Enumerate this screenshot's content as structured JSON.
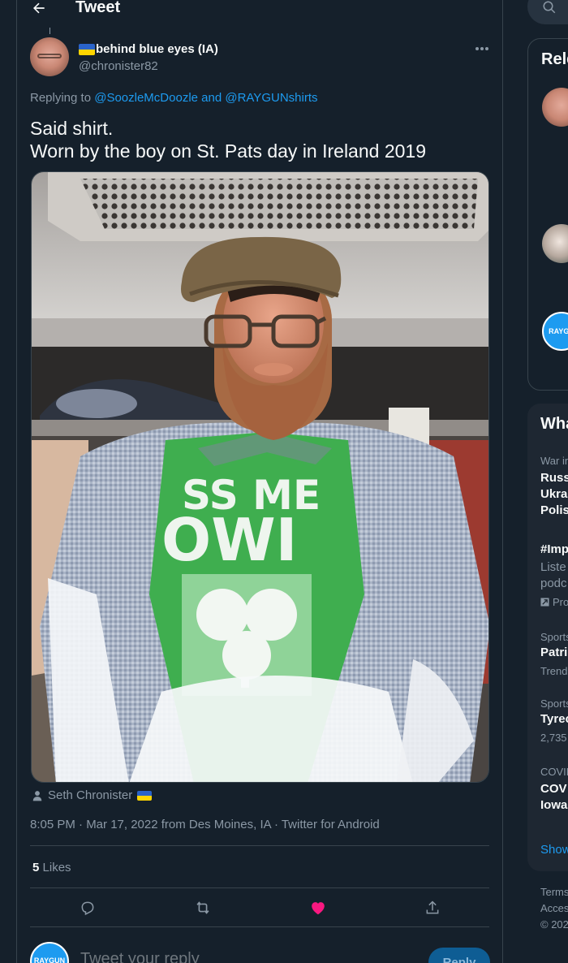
{
  "header": {
    "title": "Tweet"
  },
  "tweet": {
    "author": {
      "display_name": "behind blue eyes (IA)",
      "handle": "@chronister82"
    },
    "replying_prefix": "Replying to",
    "replying_to": "@SoozleMcDoozle and @RAYGUNshirts",
    "text_lines": [
      "Said shirt.",
      "Worn by the boy on St. Pats day in Ireland 2019"
    ],
    "photo": {
      "shirt_text_line1": "SS ME",
      "shirt_text_line2": "OWI"
    },
    "tagged_user": "Seth Chronister",
    "timestamp": "8:05 PM · Mar 17, 2022 from Des Moines, IA · Twitter for Android",
    "likes_count": "5",
    "likes_label": "Likes",
    "liked": true,
    "colors": {
      "accent": "#1d9bf0",
      "like": "#f91880",
      "background": "#15202b"
    }
  },
  "reply_box": {
    "avatar_label": "RAYGUN",
    "placeholder": "Tweet your reply",
    "button_label": "Reply"
  },
  "right_sidebar": {
    "relevant_title": "Rele",
    "relevant_avatar_label": "RAYGU",
    "whats_happening_title": "Wha",
    "trends": [
      {
        "context": "War in",
        "title_lines": [
          "Russ",
          "Ukra",
          "Polis"
        ]
      },
      {
        "title": "#Imp",
        "desc_lines": [
          "Liste",
          "podc"
        ],
        "promoted": "Pro"
      },
      {
        "context": "Sports",
        "title": "Patri",
        "meta": "Trend"
      },
      {
        "context": "Sports",
        "title": "Tyrec",
        "meta": "2,735"
      },
      {
        "context": "COVID",
        "title_lines": [
          "COV",
          "Iowa"
        ]
      }
    ],
    "show_more": "Show",
    "footer": [
      "Terms",
      "Acces",
      "© 202"
    ]
  },
  "icons": [
    "back-arrow-icon",
    "more-icon",
    "person-icon",
    "reply-icon",
    "retweet-icon",
    "heart-icon",
    "share-icon",
    "search-icon"
  ]
}
